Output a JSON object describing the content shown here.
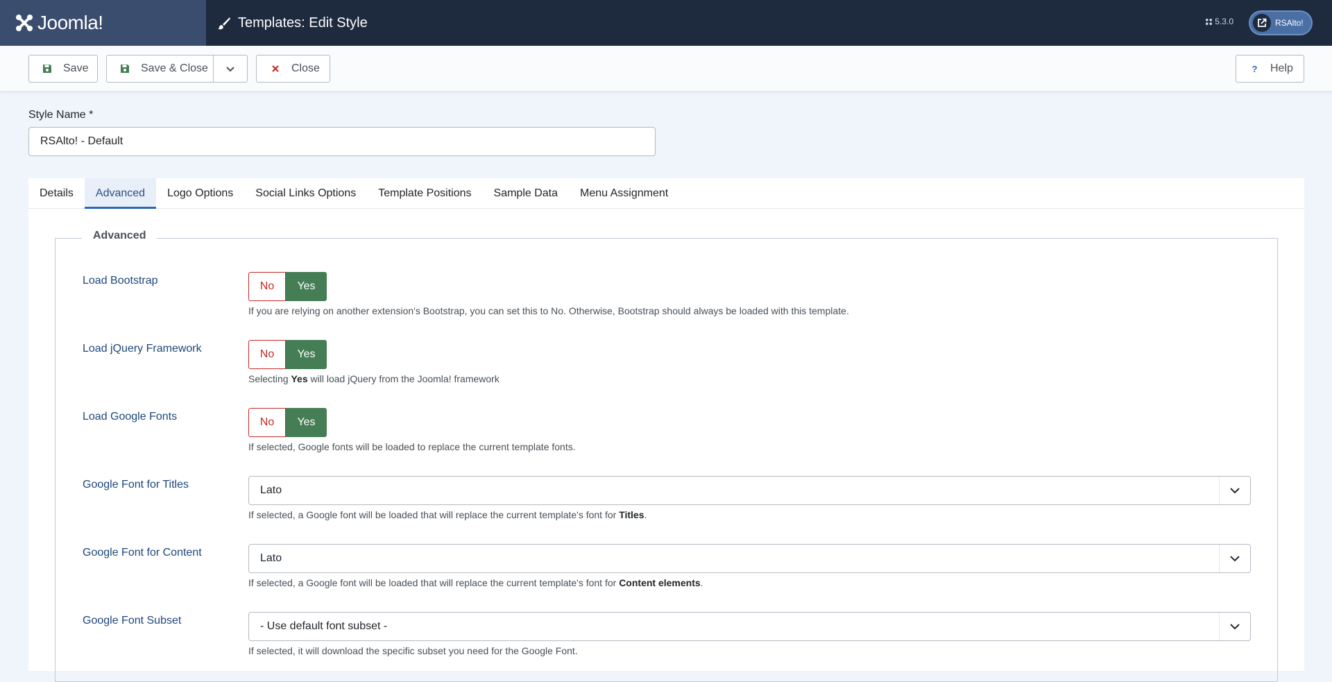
{
  "header": {
    "brand": "Joomla!",
    "title": "Templates: Edit Style",
    "version": "5.3.0",
    "user": "RSAlto!"
  },
  "toolbar": {
    "save": "Save",
    "save_close": "Save & Close",
    "close": "Close",
    "help": "Help"
  },
  "style_name": {
    "label": "Style Name *",
    "value": "RSAlto! - Default"
  },
  "tabs": [
    "Details",
    "Advanced",
    "Logo Options",
    "Social Links Options",
    "Template Positions",
    "Sample Data",
    "Menu Assignment"
  ],
  "active_tab": "Advanced",
  "fieldset": {
    "legend": "Advanced",
    "fields": [
      {
        "label": "Load Bootstrap",
        "no": "No",
        "yes": "Yes",
        "value": "Yes",
        "help": "If you are relying on another extension's Bootstrap, you can set this to No. Otherwise, Bootstrap should always be loaded with this template."
      },
      {
        "label": "Load jQuery Framework",
        "no": "No",
        "yes": "Yes",
        "value": "Yes",
        "help_pre": "Selecting ",
        "help_bold": "Yes",
        "help_post": " will load jQuery from the Joomla! framework"
      },
      {
        "label": "Load Google Fonts",
        "no": "No",
        "yes": "Yes",
        "value": "Yes",
        "help": "If selected, Google fonts will be loaded to replace the current template fonts."
      },
      {
        "label": "Google Font for Titles",
        "value": "Lato",
        "help_pre": "If selected, a Google font will be loaded that will replace the current template's font for ",
        "help_bold": "Titles",
        "help_post": "."
      },
      {
        "label": "Google Font for Content",
        "value": "Lato",
        "help_pre": "If selected, a Google font will be loaded that will replace the current template's font for ",
        "help_bold": "Content elements",
        "help_post": "."
      },
      {
        "label": "Google Font Subset",
        "value": "- Use default font subset -",
        "help": "If selected, it will download the specific subset you need for the Google Font."
      }
    ]
  },
  "colors": {
    "header_bg": "#1e2a3e",
    "logo_bg": "#3a4d6f",
    "yes_active": "#457d54",
    "no_border": "#c52827",
    "label_color": "#1d4679"
  }
}
